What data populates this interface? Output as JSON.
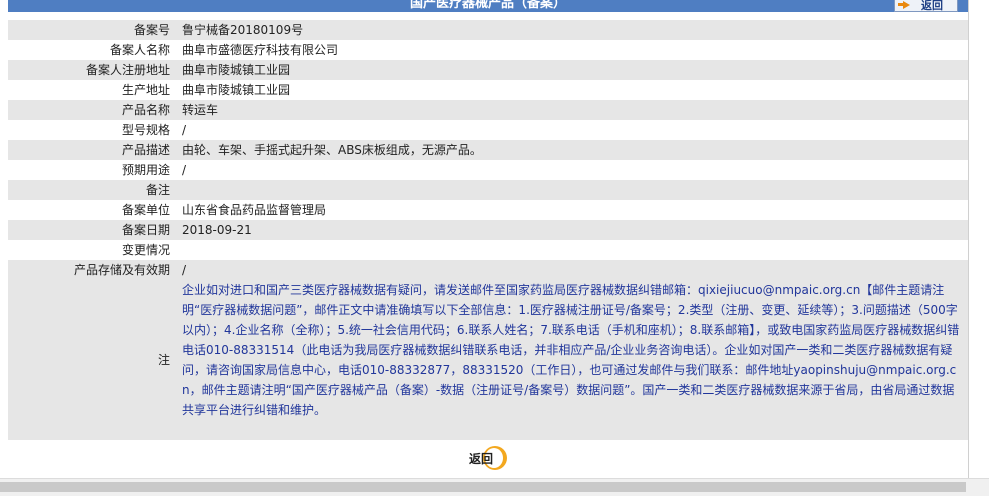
{
  "header": {
    "title": "国产医疗器械产品（备案）",
    "back_label": "返回"
  },
  "rows": [
    {
      "label": "备案号",
      "value": "鲁宁械备20180109号"
    },
    {
      "label": "备案人名称",
      "value": "曲阜市盛德医疗科技有限公司"
    },
    {
      "label": "备案人注册地址",
      "value": "曲阜市陵城镇工业园"
    },
    {
      "label": "生产地址",
      "value": "曲阜市陵城镇工业园"
    },
    {
      "label": "产品名称",
      "value": "转运车"
    },
    {
      "label": "型号规格",
      "value": "/"
    },
    {
      "label": "产品描述",
      "value": "由轮、车架、手摇式起升架、ABS床板组成，无源产品。"
    },
    {
      "label": "预期用途",
      "value": "/"
    },
    {
      "label": "备注",
      "value": ""
    },
    {
      "label": "备案单位",
      "value": "山东省食品药品监督管理局"
    },
    {
      "label": "备案日期",
      "value": "2018-09-21"
    },
    {
      "label": "变更情况",
      "value": ""
    },
    {
      "label": "产品存储及有效期",
      "value": "/"
    }
  ],
  "note": {
    "label": "注",
    "text": "企业如对进口和国产三类医疗器械数据有疑问，请发送邮件至国家药监局医疗器械数据纠错邮箱：qixiejiucuo@nmpaic.org.cn【邮件主题请注明“医疗器械数据问题”，邮件正文中请准确填写以下全部信息：1.医疗器械注册证号/备案号；2.类型（注册、变更、延续等）；3.问题描述（500字以内）；4.企业名称（全称）；5.统一社会信用代码；6.联系人姓名；7.联系电话（手机和座机）；8.联系邮箱】，或致电国家药监局医疗器械数据纠错电话010-88331514（此电话为我局医疗器械数据纠错联系电话，并非相应产品/企业业务咨询电话）。企业如对国产一类和二类医疗器械数据有疑问，请咨询国家局信息中心，电话010-88332877，88331520（工作日），也可通过发邮件与我们联系：邮件地址yaopinshuju@nmpaic.org.cn，邮件主题请注明“国产医疗器械产品（备案）-数据（注册证号/备案号）数据问题”。国产一类和二类医疗器械数据来源于省局，由省局通过数据共享平台进行纠错和维护。"
  },
  "footer": {
    "back_label": "返回"
  }
}
